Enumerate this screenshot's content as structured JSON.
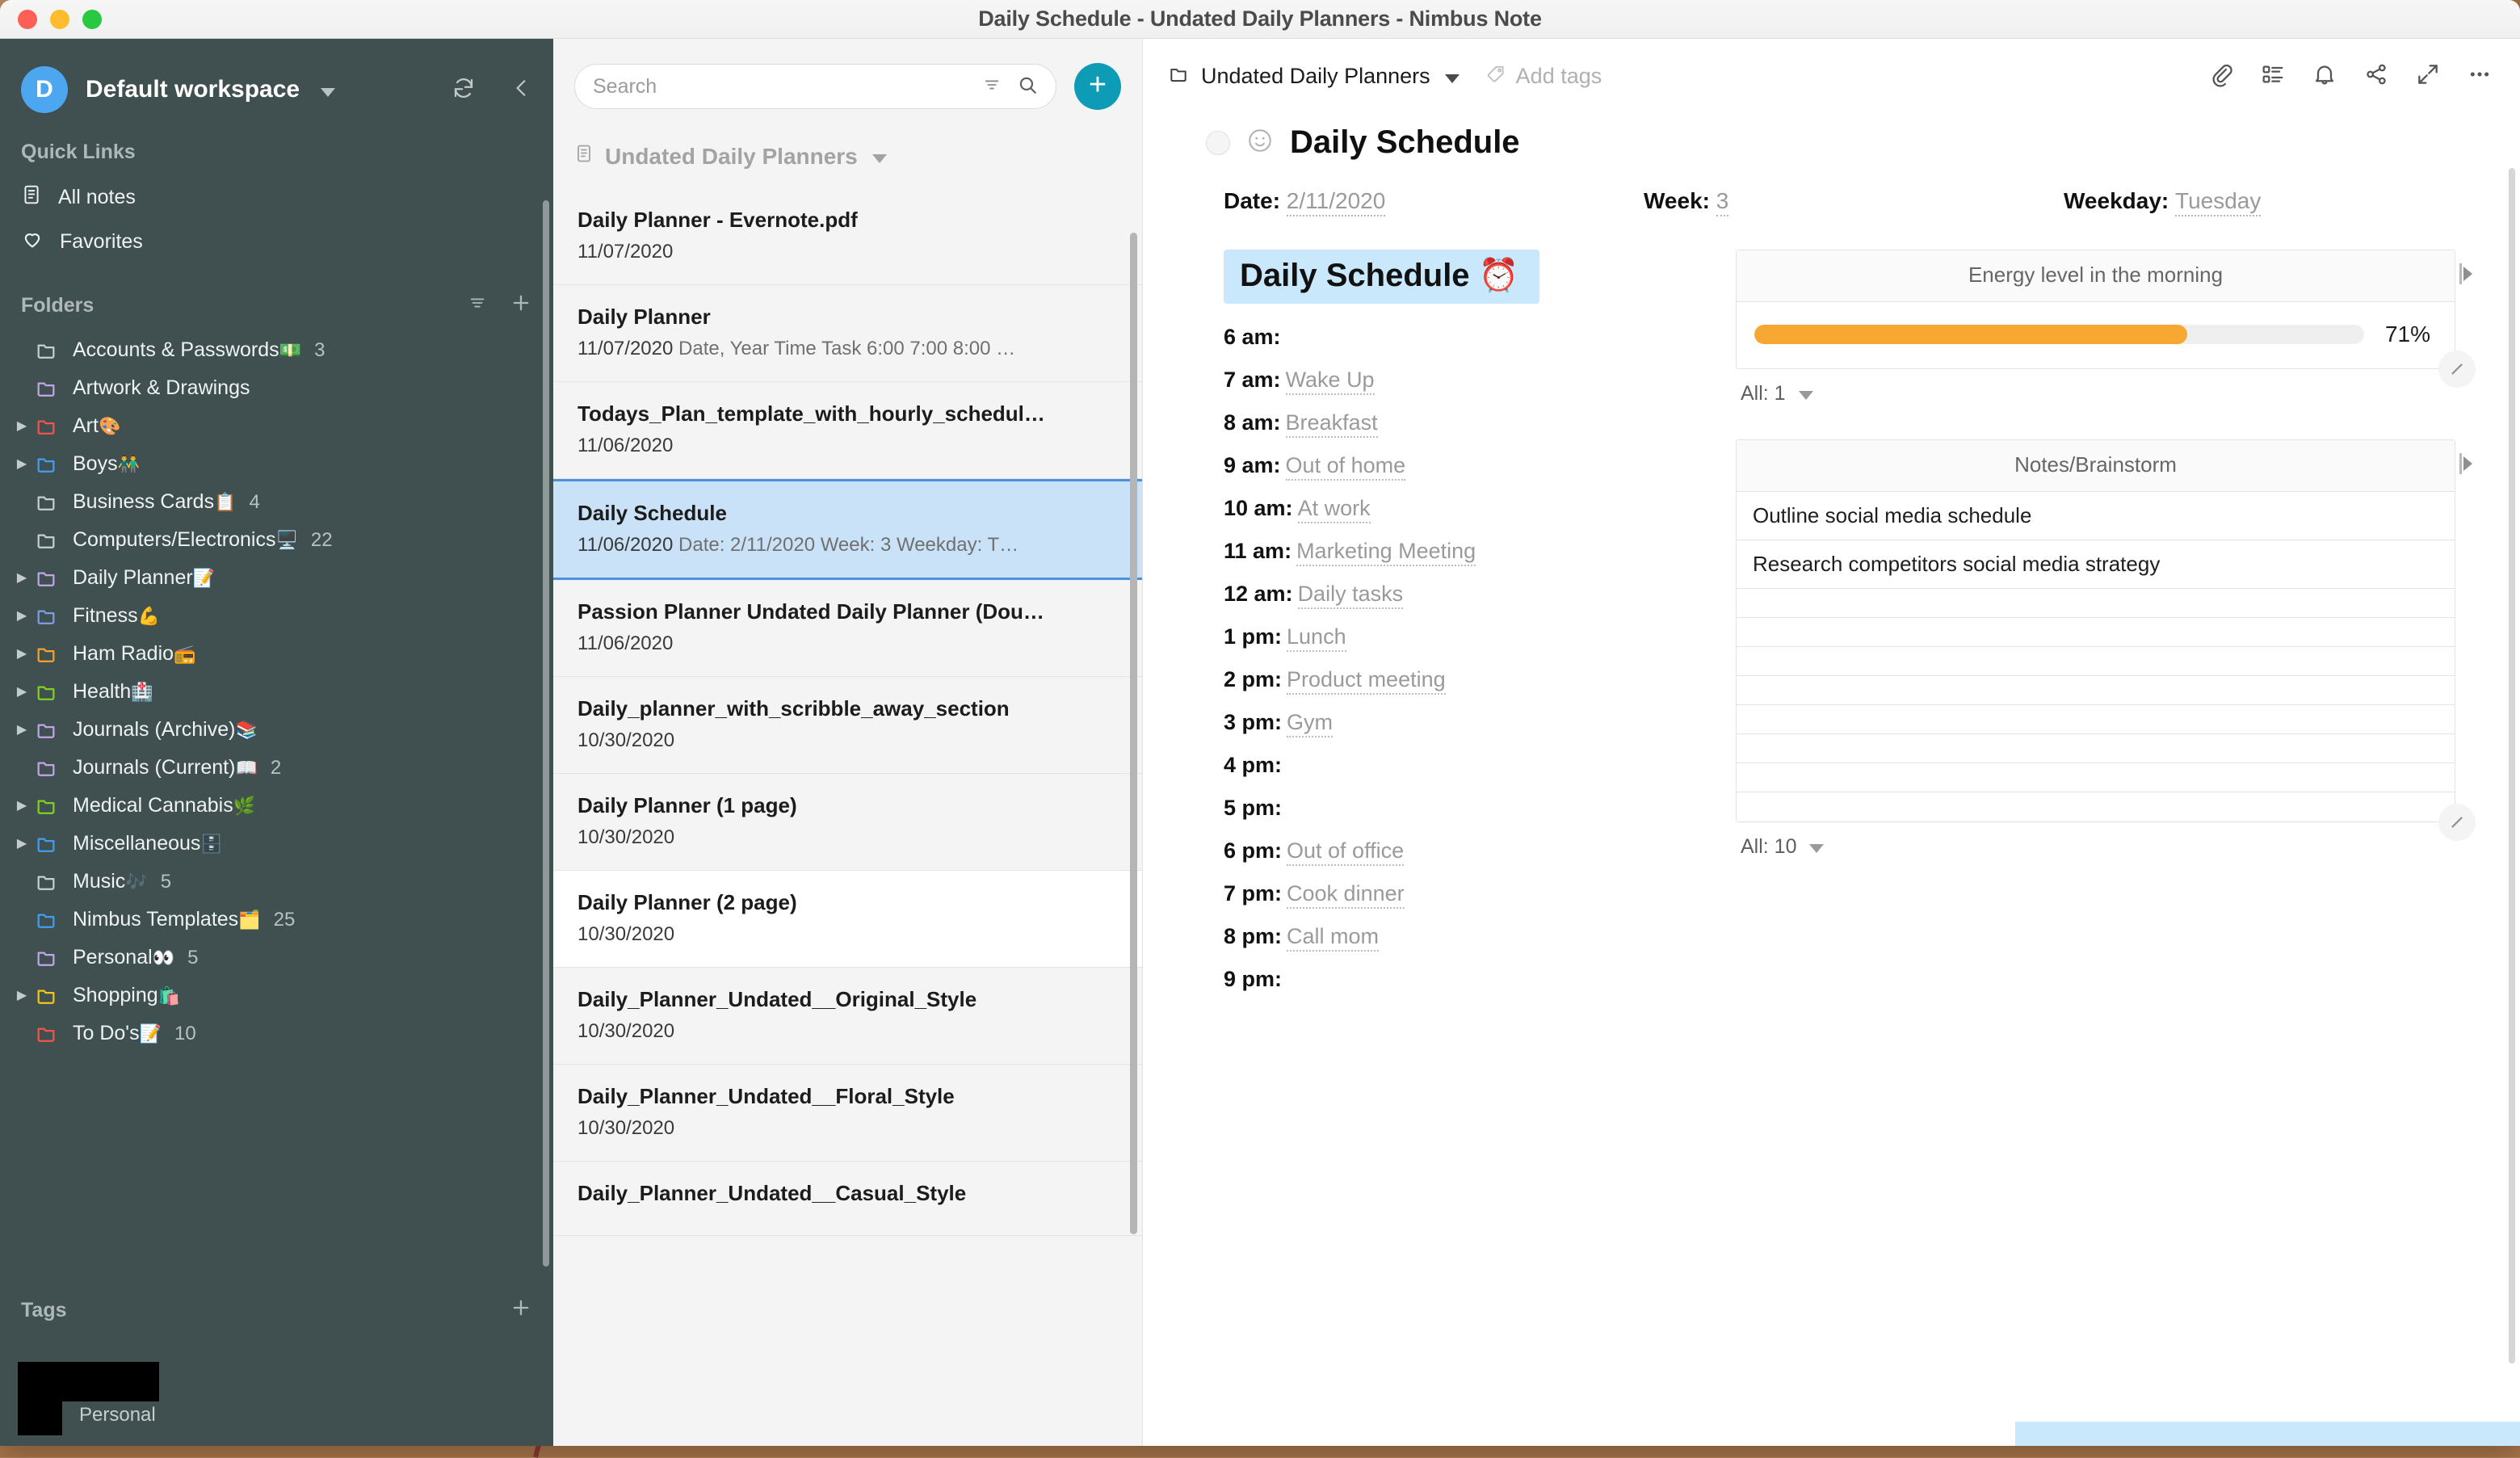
{
  "window": {
    "title": "Daily Schedule - Undated Daily Planners - Nimbus Note"
  },
  "sidebar": {
    "workspace": {
      "initial": "D",
      "name": "Default workspace"
    },
    "quick_links_title": "Quick Links",
    "quick_links": [
      {
        "label": "All notes",
        "icon": "note-icon"
      },
      {
        "label": "Favorites",
        "icon": "heart-icon"
      }
    ],
    "folders_title": "Folders",
    "folders": [
      {
        "label": "Accounts & Passwords",
        "emoji": "💵",
        "count": "3",
        "color": "#c7cfcf",
        "expandable": false
      },
      {
        "label": "Artwork & Drawings",
        "emoji": "",
        "count": "",
        "color": "#c0a6e8",
        "expandable": false
      },
      {
        "label": "Art",
        "emoji": "🎨",
        "count": "",
        "color": "#f4554a",
        "expandable": true
      },
      {
        "label": "Boys",
        "emoji": "👬",
        "count": "",
        "color": "#3ea0f0",
        "expandable": true
      },
      {
        "label": "Business Cards",
        "emoji": "📋",
        "count": "4",
        "color": "#c7cfcf",
        "expandable": false
      },
      {
        "label": "Computers/Electronics",
        "emoji": "🖥️",
        "count": "22",
        "color": "#c7cfcf",
        "expandable": false
      },
      {
        "label": "Daily Planner",
        "emoji": "📝",
        "count": "",
        "color": "#c0a6e8",
        "expandable": true
      },
      {
        "label": "Fitness",
        "emoji": "💪",
        "count": "",
        "color": "#7f9ee8",
        "expandable": true
      },
      {
        "label": "Ham Radio",
        "emoji": "📻",
        "count": "",
        "color": "#f5a32a",
        "expandable": true
      },
      {
        "label": "Health",
        "emoji": "🏥",
        "count": "",
        "color": "#7ed321",
        "expandable": true
      },
      {
        "label": "Journals (Archive)",
        "emoji": "📚",
        "count": "",
        "color": "#c0a6e8",
        "expandable": true
      },
      {
        "label": "Journals (Current)",
        "emoji": "📖",
        "count": "2",
        "color": "#c0a6e8",
        "expandable": false
      },
      {
        "label": "Medical Cannabis",
        "emoji": "🌿",
        "count": "",
        "color": "#7ed321",
        "expandable": true
      },
      {
        "label": "Miscellaneous",
        "emoji": "🗄️",
        "count": "",
        "color": "#3ea0f0",
        "expandable": true
      },
      {
        "label": "Music",
        "emoji": "🎶",
        "count": "5",
        "color": "#c7cfcf",
        "expandable": false
      },
      {
        "label": "Nimbus Templates",
        "emoji": "🗂️",
        "count": "25",
        "color": "#3ea0f0",
        "expandable": false
      },
      {
        "label": "Personal",
        "emoji": "👀",
        "count": "5",
        "color": "#c0a6e8",
        "expandable": false
      },
      {
        "label": "Shopping",
        "emoji": "🛍️",
        "count": "",
        "color": "#f5c518",
        "expandable": true
      },
      {
        "label": "To Do's",
        "emoji": "📝",
        "count": "10",
        "color": "#f4554a",
        "expandable": false
      }
    ],
    "tags_title": "Tags",
    "tag_visible_label": "Personal"
  },
  "notelist": {
    "search": {
      "placeholder": "Search",
      "value": ""
    },
    "header": "Undated Daily Planners",
    "items": [
      {
        "title": "Daily Planner - Evernote.pdf",
        "date": "11/07/2020",
        "snippet": "",
        "state": "normal"
      },
      {
        "title": "Daily Planner",
        "date": "11/07/2020",
        "snippet": "Date, Year Time Task 6:00 7:00 8:00 …",
        "state": "normal"
      },
      {
        "title": "Todays_Plan_template_with_hourly_schedul…",
        "date": "11/06/2020",
        "snippet": "",
        "state": "normal"
      },
      {
        "title": "Daily Schedule",
        "date": "11/06/2020",
        "snippet": "Date: 2/11/2020 Week: 3 Weekday: T…",
        "state": "selected"
      },
      {
        "title": "Passion Planner Undated Daily Planner (Dou…",
        "date": "11/06/2020",
        "snippet": "",
        "state": "normal"
      },
      {
        "title": "Daily_planner_with_scribble_away_section",
        "date": "10/30/2020",
        "snippet": "",
        "state": "normal"
      },
      {
        "title": "Daily Planner (1 page)",
        "date": "10/30/2020",
        "snippet": "",
        "state": "normal"
      },
      {
        "title": "Daily Planner (2 page)",
        "date": "10/30/2020",
        "snippet": "",
        "state": "hover"
      },
      {
        "title": "Daily_Planner_Undated__Original_Style",
        "date": "10/30/2020",
        "snippet": "",
        "state": "normal"
      },
      {
        "title": "Daily_Planner_Undated__Floral_Style",
        "date": "10/30/2020",
        "snippet": "",
        "state": "normal"
      },
      {
        "title": "Daily_Planner_Undated__Casual_Style",
        "date": "",
        "snippet": "",
        "state": "normal"
      }
    ]
  },
  "editor": {
    "breadcrumb_folder": "Undated Daily Planners",
    "add_tags_label": "Add tags",
    "actions": [
      {
        "name": "attach-icon"
      },
      {
        "name": "outline-icon"
      },
      {
        "name": "reminder-icon"
      },
      {
        "name": "share-icon"
      },
      {
        "name": "fullscreen-icon"
      },
      {
        "name": "more-icon"
      }
    ],
    "note_title": "Daily Schedule",
    "note_emoji": "🙂",
    "meta": {
      "date_label": "Date:",
      "date_value": "2/11/2020",
      "week_label": "Week:",
      "week_value": "3",
      "weekday_label": "Weekday:",
      "weekday_value": "Tuesday"
    },
    "schedule_heading": "Daily Schedule ⏰",
    "schedule": [
      {
        "time": "6 am:",
        "task": ""
      },
      {
        "time": "7 am:",
        "task": "Wake Up"
      },
      {
        "time": "8 am:",
        "task": "Breakfast"
      },
      {
        "time": "9 am:",
        "task": "Out of home"
      },
      {
        "time": "10 am:",
        "task": "At work"
      },
      {
        "time": "11 am:",
        "task": "Marketing Meeting"
      },
      {
        "time": "12 am:",
        "task": "Daily tasks"
      },
      {
        "time": "1 pm:",
        "task": "Lunch"
      },
      {
        "time": "2 pm:",
        "task": "Product meeting"
      },
      {
        "time": "3 pm:",
        "task": "Gym"
      },
      {
        "time": "4 pm:",
        "task": ""
      },
      {
        "time": "5 pm:",
        "task": ""
      },
      {
        "time": "6 pm:",
        "task": "Out of office"
      },
      {
        "time": "7 pm:",
        "task": "Cook dinner"
      },
      {
        "time": "8 pm:",
        "task": "Call mom"
      },
      {
        "time": "9 pm:",
        "task": ""
      }
    ],
    "energy_widget": {
      "header": "Energy level in the morning",
      "percent_label": "71%",
      "percent_value": 71,
      "bar_color": "#f7a833",
      "footer": "All: 1"
    },
    "notes_widget": {
      "header": "Notes/Brainstorm",
      "rows": [
        "Outline social media schedule",
        "Research competitors social media strategy",
        "",
        "",
        "",
        "",
        "",
        "",
        "",
        ""
      ],
      "footer": "All: 10"
    }
  }
}
